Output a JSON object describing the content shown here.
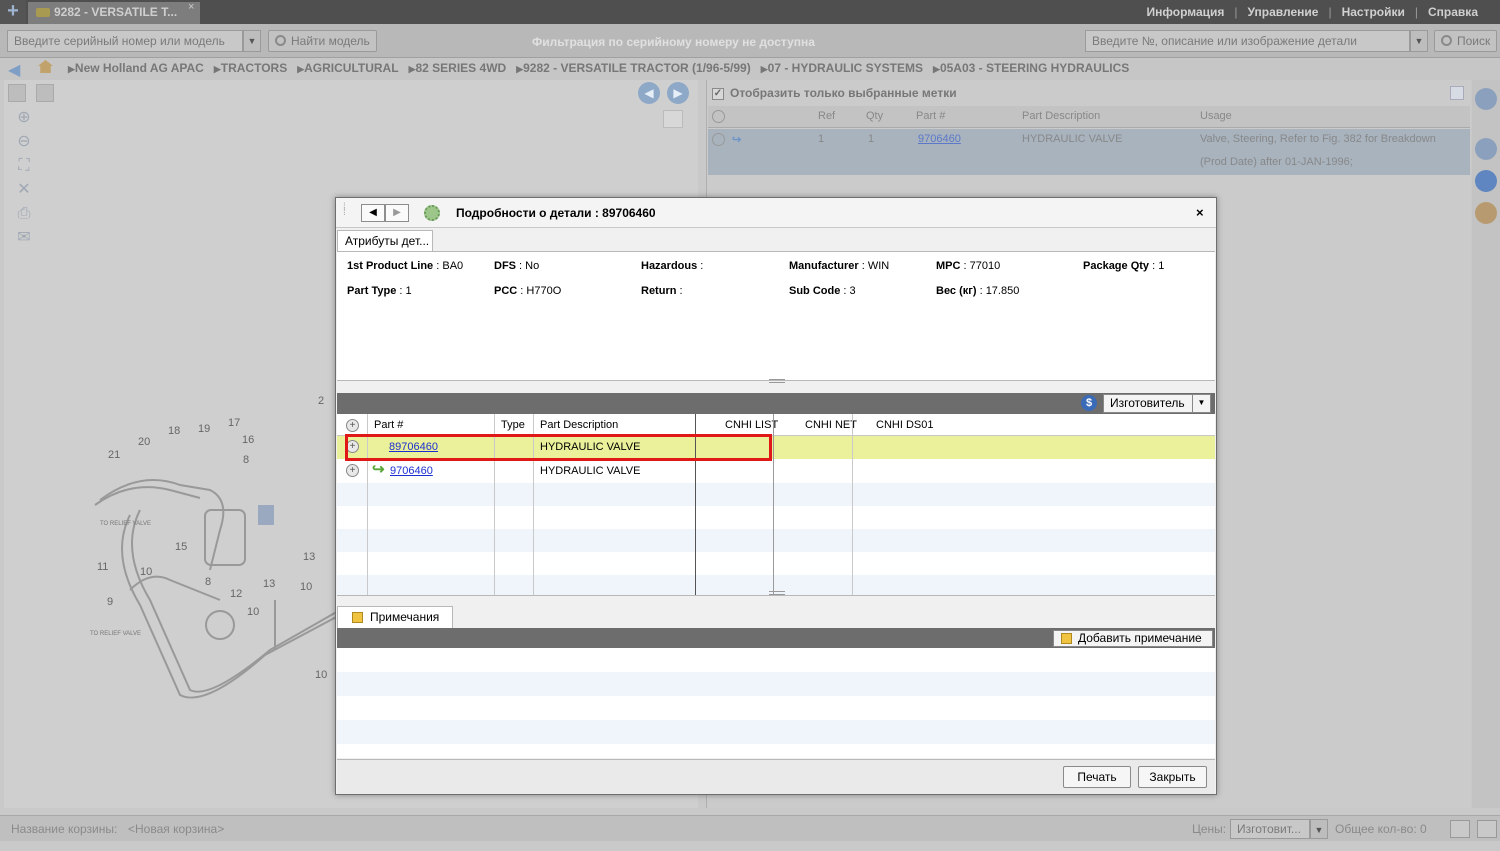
{
  "tab": {
    "title": "9282 - VERSATILE T...",
    "close": "×",
    "add": "+"
  },
  "top_menu": [
    "Информация",
    "Управление",
    "Настройки",
    "Справка"
  ],
  "toolbar": {
    "serial_placeholder": "Введите серийный номер или модель",
    "find_model": "Найти модель",
    "filter_msg": "Фильтрация по серийному номеру не доступна",
    "part_search_placeholder": "Введите №, описание или изображение детали",
    "search": "Поиск"
  },
  "breadcrumb": [
    "New Holland AG APAC",
    "TRACTORS",
    "AGRICULTURAL",
    "82 SERIES 4WD",
    "9282 - VERSATILE TRACTOR (1/96-5/99)",
    "07 - HYDRAULIC SYSTEMS",
    "05A03 - STEERING HYDRAULICS"
  ],
  "right_panel": {
    "only_selected": "Отобразить только выбранные метки",
    "columns": [
      "Ref",
      "Qty",
      "Part #",
      "Part Description",
      "Usage"
    ],
    "row": {
      "ref": "1",
      "qty": "1",
      "part": "9706460",
      "desc": "HYDRAULIC VALVE",
      "usage": "Valve, Steering, Refer to Fig. 382 for Breakdown",
      "usage2": "(Prod Date) after 01-JAN-1996;"
    }
  },
  "diagram": {
    "callouts": [
      "2",
      "17",
      "19",
      "18",
      "16",
      "20",
      "21",
      "8",
      "1",
      "15",
      "13",
      "11",
      "10",
      "9",
      "12",
      "13",
      "10",
      "10",
      "8",
      "10"
    ],
    "relief1": "TO\nRELIEF\nVALVE",
    "relief2": "TO\nRELIEF VALVE"
  },
  "dialog": {
    "title": "Подробности о детали : 89706460",
    "close": "×",
    "attr_tab": "Атрибуты дет...",
    "attributes": {
      "product_line": {
        "label": "1st Product Line",
        "value": "BA0"
      },
      "dfs": {
        "label": "DFS",
        "value": "No"
      },
      "hazardous": {
        "label": "Hazardous",
        "value": ""
      },
      "manufacturer": {
        "label": "Manufacturer",
        "value": "WIN"
      },
      "mpc": {
        "label": "MPC",
        "value": "77010"
      },
      "package_qty": {
        "label": "Package Qty",
        "value": "1"
      },
      "part_type": {
        "label": "Part Type",
        "value": "1"
      },
      "pcc": {
        "label": "PCC",
        "value": "H770O"
      },
      "return": {
        "label": "Return",
        "value": ""
      },
      "sub_code": {
        "label": "Sub Code",
        "value": "3"
      },
      "weight": {
        "label": "Вес (кг)",
        "value": "17.850"
      }
    },
    "manufacturer_select": "Изготовитель",
    "parts_columns": [
      "Part #",
      "Type",
      "Part Description",
      "CNHI LIST",
      "CNHI NET",
      "CNHI DS01"
    ],
    "parts_rows": [
      {
        "part": "89706460",
        "type": "",
        "desc": "HYDRAULIC VALVE",
        "selected": true
      },
      {
        "part": "9706460",
        "type": "",
        "desc": "HYDRAULIC VALVE",
        "selected": false
      }
    ],
    "notes_tab": "Примечания",
    "add_note": "Добавить примечание",
    "print": "Печать",
    "close_btn": "Закрыть"
  },
  "bottom": {
    "cart_label": "Название корзины:",
    "cart_name": "<Новая корзина>",
    "prices_label": "Цены:",
    "prices_value": "Изготовит...",
    "total": "Общее кол-во: 0"
  },
  "colors": {
    "highlight_row": "#ebf19a",
    "red_outline": "#e01818",
    "link": "#1b2fd3",
    "dark_strip": "#6d6d6d"
  }
}
